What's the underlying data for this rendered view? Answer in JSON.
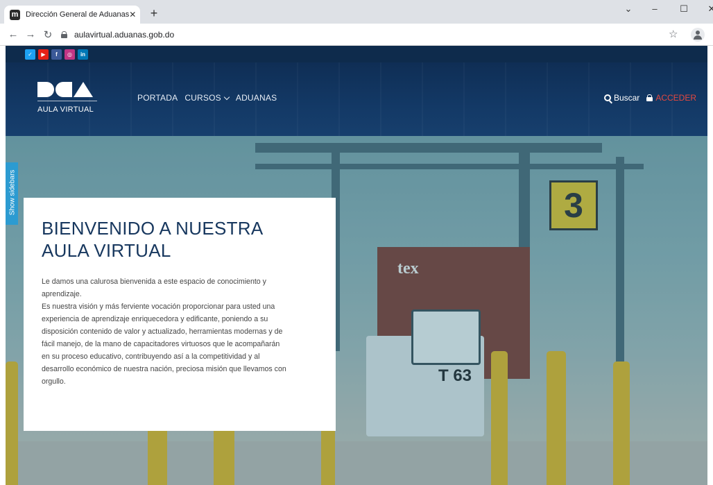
{
  "browser": {
    "tab_title": "Dirección General de Aduanas",
    "favicon_letter": "m",
    "url": "aulavirtual.aduanas.gob.do",
    "colors": {
      "tabbar": "#dee1e6",
      "toolbar": "#ffffff"
    }
  },
  "social": [
    {
      "name": "twitter",
      "glyph": "✓",
      "color": "#1da1f2"
    },
    {
      "name": "youtube",
      "glyph": "▶",
      "color": "#e62117"
    },
    {
      "name": "facebook",
      "glyph": "f",
      "color": "#3b5998"
    },
    {
      "name": "instagram",
      "glyph": "◎",
      "color": "#c13584"
    },
    {
      "name": "linkedin",
      "glyph": "in",
      "color": "#0077b5"
    }
  ],
  "header": {
    "logo_text": "AULA VIRTUAL",
    "nav": [
      {
        "label": "PORTADA"
      },
      {
        "label": "CURSOS",
        "has_dropdown": true
      },
      {
        "label": "ADUANAS"
      }
    ],
    "search_label": "Buscar",
    "login_label": "ACCEDER",
    "colors": {
      "header_bg": "#143766",
      "login": "#e5483f"
    }
  },
  "sidebar_toggle": {
    "label": "Show sidebars",
    "color": "#2c9bd1"
  },
  "hero": {
    "container_text": "tex",
    "truck_number": "T 63",
    "gate_number": "3"
  },
  "welcome": {
    "title": "BIENVENIDO A NUESTRA\nAULA VIRTUAL",
    "body": "Le damos una calurosa bienvenida a este espacio de conocimiento y\naprendizaje.\nEs nuestra visión y más ferviente vocación proporcionar para usted una\nexperiencia de aprendizaje enriquecedora y edificante, poniendo a su\ndisposición contenido de valor y actualizado, herramientas modernas y de\nfácil manejo, de la mano de capacitadores virtuosos que le acompañarán\nen su proceso educativo, contribuyendo así a la competitividad y al\ndesarrollo económico de nuestra nación, preciosa misión que llevamos con\norgullo.",
    "title_color": "#17375e"
  }
}
